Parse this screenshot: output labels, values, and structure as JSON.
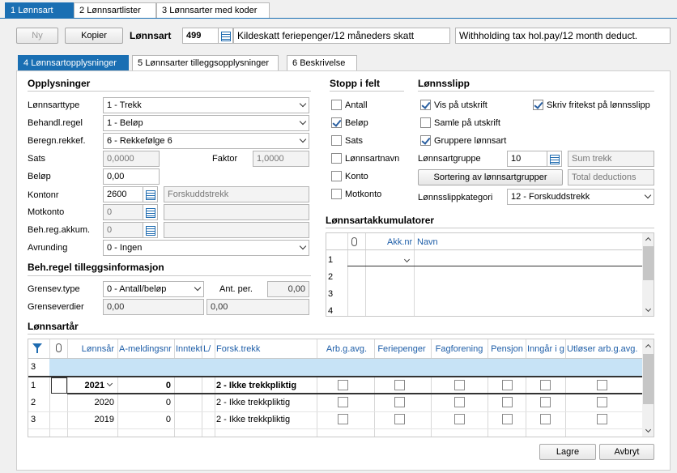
{
  "top_tabs": [
    {
      "key": "1",
      "label": "Lønnsart"
    },
    {
      "key": "2",
      "label": "Lønnsartlister"
    },
    {
      "key": "3",
      "label": "Lønnsarter med koder"
    }
  ],
  "toolbar": {
    "new_label": "Ny",
    "copy_label": "Kopier",
    "lonnsart_label": "Lønnsart",
    "lonnsart_number": "499",
    "name_no": "Kildeskatt feriepenger/12 måneders skatt",
    "name_en": "Withholding tax hol.pay/12 month deduct."
  },
  "sub_tabs": [
    {
      "key": "4",
      "label": "Lønnsartopplysninger"
    },
    {
      "key": "5",
      "label": "Lønnsarter tilleggsopplysninger"
    },
    {
      "key": "6",
      "label": "Beskrivelse"
    }
  ],
  "opplysninger": {
    "title": "Opplysninger",
    "lonnsarttype_label": "Lønnsarttype",
    "lonnsarttype_value": "1 - Trekk",
    "behandl_label": "Behandl.regel",
    "behandl_value": "1 - Beløp",
    "beregn_label": "Beregn.rekkef.",
    "beregn_value": "6 - Rekkefølge 6",
    "sats_label": "Sats",
    "sats_value": "0,0000",
    "faktor_label": "Faktor",
    "faktor_value": "1,0000",
    "belop_label": "Beløp",
    "belop_value": "0,00",
    "kontonr_label": "Kontonr",
    "kontonr_value": "2600",
    "kontonr_name": "Forskuddstrekk",
    "motkonto_label": "Motkonto",
    "motkonto_value": "0",
    "behreg_label": "Beh.reg.akkum.",
    "behreg_value": "0",
    "avrunding_label": "Avrunding",
    "avrunding_value": "0 - Ingen"
  },
  "behregel": {
    "title": "Beh.regel tilleggsinformasjon",
    "grensev_label": "Grensev.type",
    "grensev_value": "0 - Antall/beløp",
    "antper_label": "Ant. per.",
    "antper_value": "0,00",
    "grenseverdier_label": "Grenseverdier",
    "grense1": "0,00",
    "grense2": "0,00"
  },
  "stopp": {
    "title": "Stopp i felt",
    "items": [
      {
        "label": "Antall",
        "checked": false
      },
      {
        "label": "Beløp",
        "checked": true
      },
      {
        "label": "Sats",
        "checked": false
      },
      {
        "label": "Lønnsartnavn",
        "checked": false
      },
      {
        "label": "Konto",
        "checked": false
      },
      {
        "label": "Motkonto",
        "checked": false
      }
    ]
  },
  "lonnsslipp": {
    "title": "Lønnsslipp",
    "vis": "Vis på utskrift",
    "skriv": "Skriv fritekst på lønnsslipp",
    "samle": "Samle på utskrift",
    "gruppere": "Gruppere lønnsart",
    "gruppe_label": "Lønnsartgruppe",
    "gruppe_value": "10",
    "gruppe_name": "Sum trekk",
    "sortering_label": "Sortering av lønnsartgrupper",
    "gruppe_name_en": "Total deductions",
    "kategori_label": "Lønnsslippkategori",
    "kategori_value": "12 - Forskuddstrekk"
  },
  "akkumulatorer": {
    "title": "Lønnsartakkumulatorer",
    "col_akk": "Akk.nr",
    "col_navn": "Navn",
    "rows": [
      "1",
      "2",
      "3",
      "4"
    ]
  },
  "lonnsartar": {
    "title": "Lønnsartår",
    "columns": [
      "Lønnsår",
      "A-meldingsnr",
      "Inntekt",
      "L/",
      "Forsk.trekk",
      "Arb.g.avg.",
      "Feriepenger",
      "Fagforening",
      "Pensjon",
      "Inngår i gr",
      "Utløser arb.g.avg."
    ],
    "filter_row": "3",
    "rows": [
      {
        "num": "1",
        "year": "2021",
        "amelding": "0",
        "forsk": "2 - Ikke trekkpliktig"
      },
      {
        "num": "2",
        "year": "2020",
        "amelding": "0",
        "forsk": "2 - Ikke trekkpliktig"
      },
      {
        "num": "3",
        "year": "2019",
        "amelding": "0",
        "forsk": "2 - Ikke trekkpliktig"
      }
    ]
  },
  "footer": {
    "save_label": "Lagre",
    "cancel_label": "Avbryt"
  }
}
